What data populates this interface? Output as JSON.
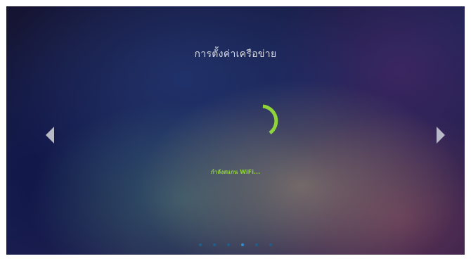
{
  "screen": {
    "title": "การตั้งค่าเครือข่าย",
    "status": "กำลังสแกน WiFi...",
    "status_color": "#8fd43a",
    "spinner_color": "#8fd43a"
  },
  "navigation": {
    "prev_icon": "chevron-left-icon",
    "next_icon": "chevron-right-icon",
    "arrow_color": "#b8b9c6"
  },
  "pagination": {
    "total": 6,
    "active_index": 3,
    "dot_color": "#1f5f8a",
    "active_color": "#2f8fd0"
  }
}
